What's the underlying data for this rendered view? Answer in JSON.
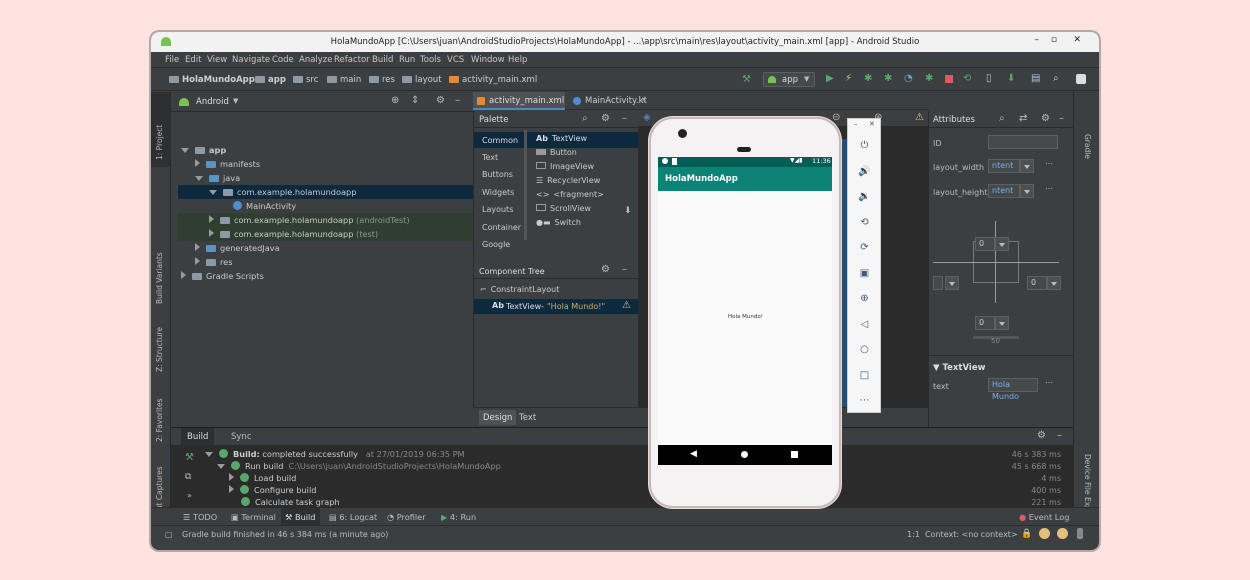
{
  "window": {
    "title": "HolaMundoApp [C:\\Users\\juan\\AndroidStudioProjects\\HolaMundoApp] - ...\\app\\src\\main\\res\\layout\\activity_main.xml [app] - Android Studio"
  },
  "menu": [
    "File",
    "Edit",
    "View",
    "Navigate",
    "Code",
    "Analyze",
    "Refactor",
    "Build",
    "Run",
    "Tools",
    "VCS",
    "Window",
    "Help"
  ],
  "breadcrumbs": [
    "HolaMundoApp",
    "app",
    "src",
    "main",
    "res",
    "layout",
    "activity_main.xml"
  ],
  "run_config": "app",
  "left_strip": [
    "1: Project",
    "Build Variants",
    "Z: Structure",
    "2: Favorites",
    "Layout Captures"
  ],
  "project": {
    "view_selector": "Android",
    "tree": [
      {
        "label": "app"
      },
      {
        "label": "manifests"
      },
      {
        "label": "java"
      },
      {
        "label": "com.example.holamundoapp"
      },
      {
        "label": "MainActivity"
      },
      {
        "label": "com.example.holamundoapp",
        "suffix": " (androidTest)"
      },
      {
        "label": "com.example.holamundoapp",
        "suffix": " (test)"
      },
      {
        "label": "generatedJava"
      },
      {
        "label": "res"
      },
      {
        "label": "Gradle Scripts"
      }
    ]
  },
  "editor_tabs": [
    "activity_main.xml",
    "MainActivity.kt"
  ],
  "palette": {
    "title": "Palette",
    "categories": [
      "Common",
      "Text",
      "Buttons",
      "Widgets",
      "Layouts",
      "Container",
      "Google"
    ],
    "items": [
      "TextView",
      "Button",
      "ImageView",
      "RecyclerView",
      "<fragment>",
      "ScrollView",
      "Switch"
    ]
  },
  "component_tree": {
    "title": "Component Tree",
    "root": "ConstraintLayout",
    "child": "TextView",
    "child_text": "\"Hola Mundo!\""
  },
  "design_tabs": [
    "Design",
    "Text"
  ],
  "attributes": {
    "title": "Attributes",
    "id_label": "ID",
    "layout_width_label": "layout_width",
    "layout_width_value": "ntent",
    "layout_height_label": "layout_height",
    "layout_height_value": "ntent",
    "margin_top": "0",
    "margin_left": "0",
    "margin_right": "0",
    "margin_bottom": "0",
    "bias": "50",
    "section": "TextView",
    "text_label": "text",
    "text_value": "Hola Mundo"
  },
  "right_strip": [
    "Gradle",
    "Device File Explorer"
  ],
  "phone": {
    "time": "11:36",
    "app_title": "HolaMundoApp",
    "hello": "Hola Mundo!",
    "accent": "#0c8377"
  },
  "build": {
    "tabs": [
      "Build",
      "Sync"
    ],
    "rows": [
      {
        "label": "Build:",
        "text": " completed successfully",
        "extra": "at 27/01/2019 06:35 PM",
        "time": "46 s 383 ms"
      },
      {
        "label": "Run build",
        "text": "",
        "extra": "C:\\Users\\juan\\AndroidStudioProjects\\HolaMundoApp",
        "time": "45 s 668 ms"
      },
      {
        "label": "Load build",
        "text": "",
        "extra": "",
        "time": "4 ms"
      },
      {
        "label": "Configure build",
        "text": "",
        "extra": "",
        "time": "400 ms"
      },
      {
        "label": "Calculate task graph",
        "text": "",
        "extra": "",
        "time": "221 ms"
      }
    ]
  },
  "bottom_tabs": [
    "TODO",
    "Terminal",
    "Build",
    "6: Logcat",
    "Profiler",
    "4: Run"
  ],
  "event_log": "Event Log",
  "status": {
    "message": "Gradle build finished in 46 s 384 ms (a minute ago)",
    "position": "1:1",
    "context": "Context: <no context>"
  }
}
